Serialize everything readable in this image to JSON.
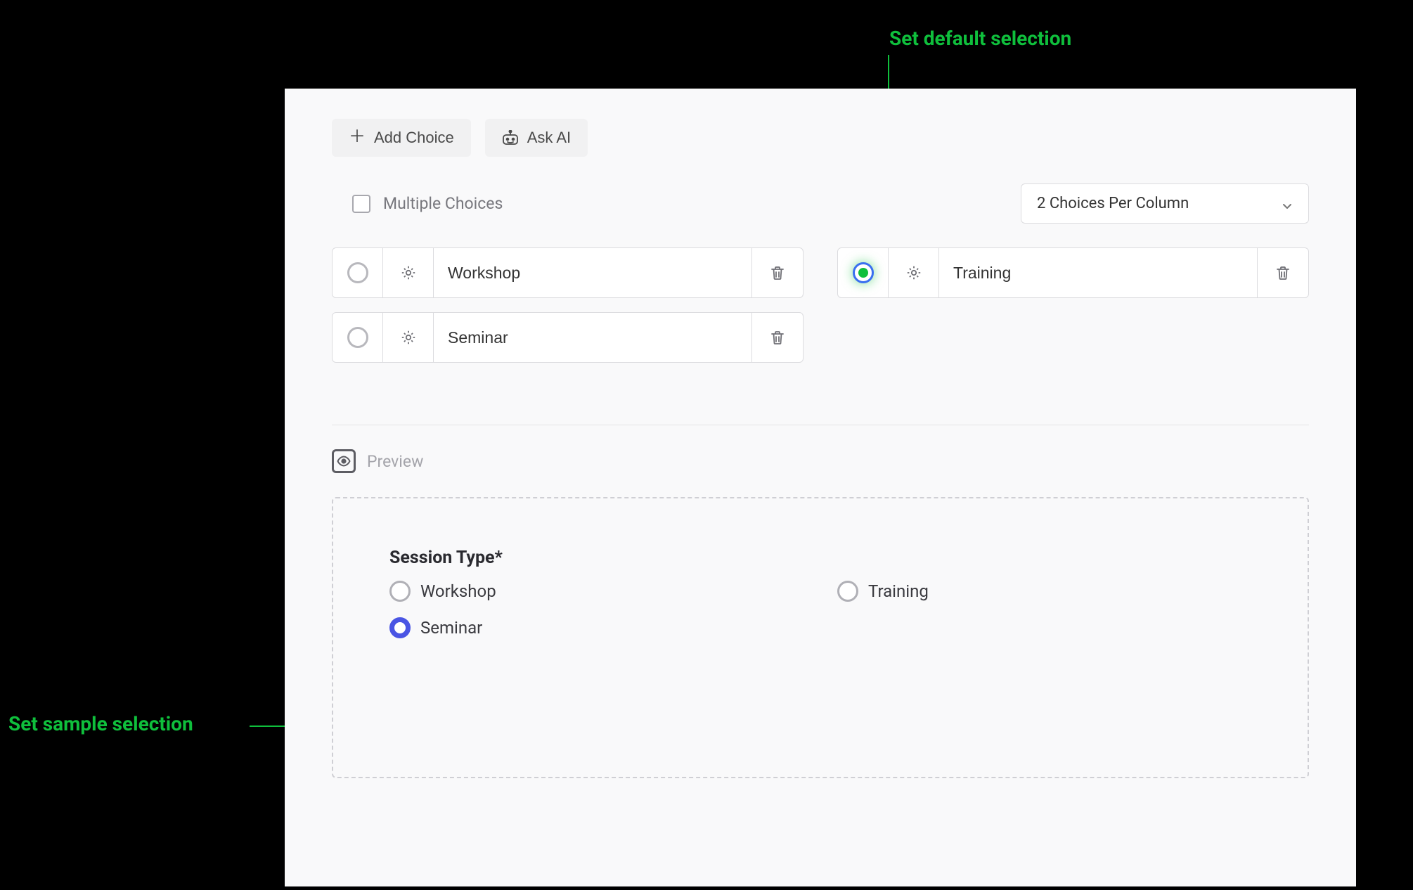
{
  "annotations": {
    "set_default_selection": "Set default selection",
    "set_sample_selection": "Set sample selection"
  },
  "toolbar": {
    "add_choice_label": "Add Choice",
    "ask_ai_label": "Ask AI"
  },
  "settings": {
    "multiple_choices_label": "Multiple Choices",
    "columns_dropdown_value": "2 Choices Per Column"
  },
  "choices": [
    {
      "value": "Workshop",
      "default_selected": false
    },
    {
      "value": "Training",
      "default_selected": true
    },
    {
      "value": "Seminar",
      "default_selected": false
    }
  ],
  "preview": {
    "section_label": "Preview",
    "field_label": "Session Type*",
    "options": [
      {
        "label": "Workshop",
        "checked": false
      },
      {
        "label": "Training",
        "checked": false
      },
      {
        "label": "Seminar",
        "checked": true
      }
    ]
  }
}
